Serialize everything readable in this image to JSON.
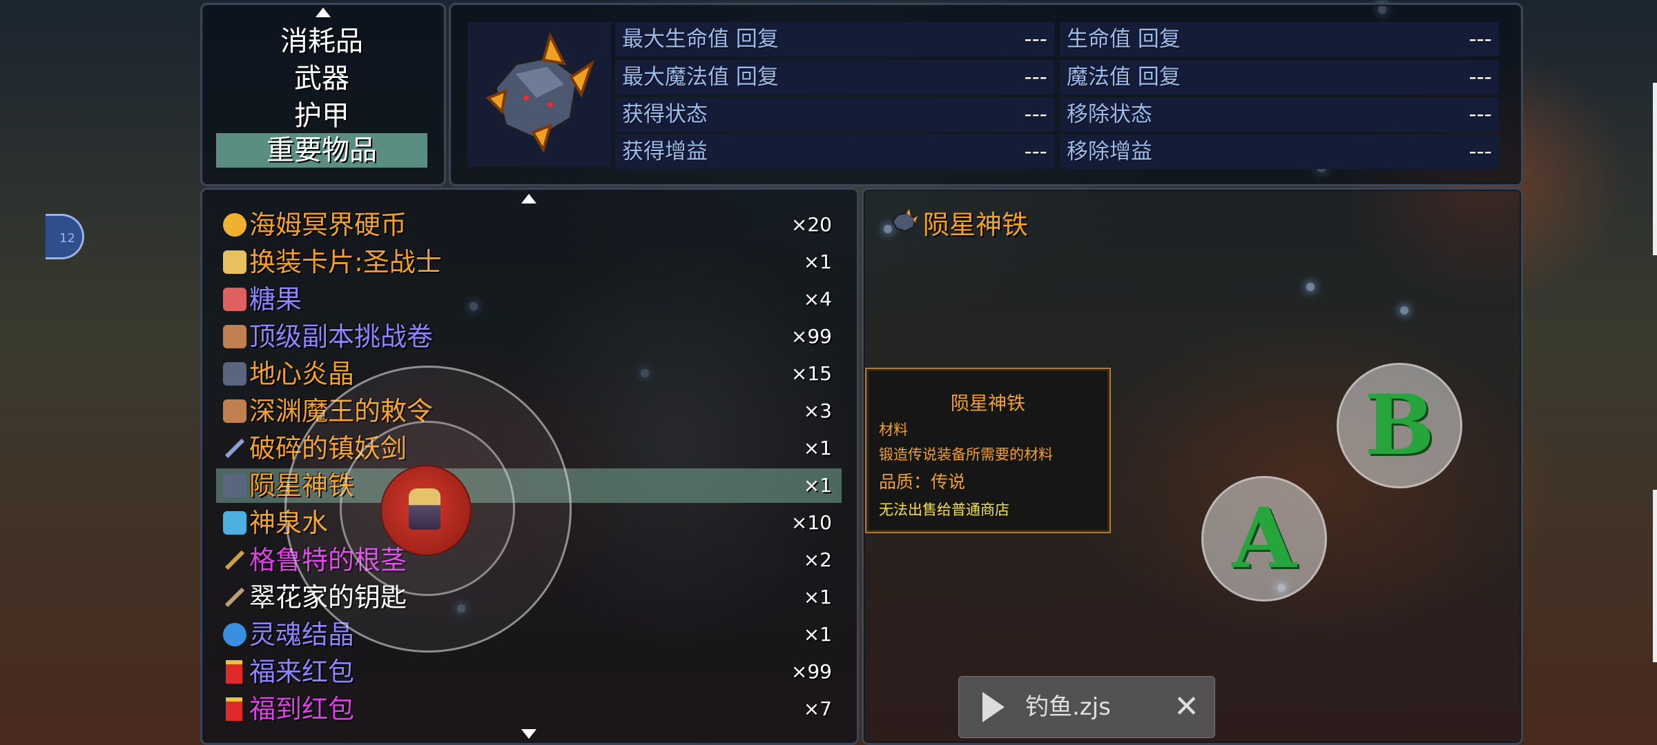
{
  "categories": {
    "items": [
      {
        "label": "消耗品"
      },
      {
        "label": "武器"
      },
      {
        "label": "护甲"
      },
      {
        "label": "重要物品",
        "selected": true
      }
    ]
  },
  "stats": {
    "rows": [
      {
        "left_label": "最大生命值 回复",
        "left_value": "---",
        "right_label": "生命值 回复",
        "right_value": "---"
      },
      {
        "left_label": "最大魔法值 回复",
        "left_value": "---",
        "right_label": "魔法值 回复",
        "right_value": "---"
      },
      {
        "left_label": "获得状态",
        "left_value": "---",
        "right_label": "移除状态",
        "right_value": "---"
      },
      {
        "left_label": "获得增益",
        "left_value": "---",
        "right_label": "移除增益",
        "right_value": "---"
      }
    ]
  },
  "items": [
    {
      "name": "海姆冥界硬币",
      "qty": "×20",
      "color": "#f5a028",
      "icon": "coin-icon"
    },
    {
      "name": "换装卡片:圣战士",
      "qty": "×1",
      "color": "#f5a028",
      "icon": "card-icon"
    },
    {
      "name": "糖果",
      "qty": "×4",
      "color": "#8e84ff",
      "icon": "candy-icon"
    },
    {
      "name": "顶级副本挑战卷",
      "qty": "×99",
      "color": "#8e84ff",
      "icon": "scroll-icon"
    },
    {
      "name": "地心炎晶",
      "qty": "×15",
      "color": "#f5a028",
      "icon": "ore-icon"
    },
    {
      "name": "深渊魔王的敕令",
      "qty": "×3",
      "color": "#f5a028",
      "icon": "scroll-icon"
    },
    {
      "name": "破碎的镇妖剑",
      "qty": "×1",
      "color": "#f5a028",
      "icon": "sword-icon"
    },
    {
      "name": "陨星神铁",
      "qty": "×1",
      "color": "#f5a028",
      "icon": "ore-icon",
      "selected": true
    },
    {
      "name": "神泉水",
      "qty": "×10",
      "color": "#f5a028",
      "icon": "potion-icon"
    },
    {
      "name": "格鲁特的根茎",
      "qty": "×2",
      "color": "#e040e8",
      "icon": "root-icon"
    },
    {
      "name": "翠花家的钥匙",
      "qty": "×1",
      "color": "#ffffff",
      "icon": "key-icon"
    },
    {
      "name": "灵魂结晶",
      "qty": "×1",
      "color": "#8e84ff",
      "icon": "crystal-icon"
    },
    {
      "name": "福来红包",
      "qty": "×99",
      "color": "#8e84ff",
      "icon": "red-envelope-icon"
    },
    {
      "name": "福到红包",
      "qty": "×7",
      "color": "#e040e8",
      "icon": "red-envelope-icon"
    }
  ],
  "detail": {
    "title": "陨星神铁",
    "tooltip": {
      "title": "陨星神铁",
      "type": "材料",
      "description": "锻造传说装备所需要的材料",
      "quality": "品质：传说",
      "note": "无法出售给普通商店"
    }
  },
  "controls": {
    "btn_a": "A",
    "btn_b": "B",
    "side_badge": "12"
  },
  "script_bar": {
    "name": "钓鱼.zjs",
    "close": "✕"
  },
  "colors": {
    "orange_text": "#f5a028",
    "purple_text": "#8e84ff",
    "magenta_text": "#e040e8",
    "selected_row": "#5a8e82",
    "stat_label": "#9bbcee",
    "button_letter": "#27a53d"
  }
}
